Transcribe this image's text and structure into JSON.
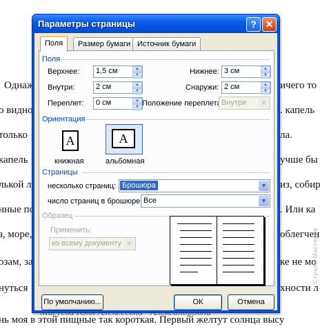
{
  "background": {
    "lines": [
      "Однаж",
      "о видно",
      "только",
      "капель",
      "лькой л",
      "нные по",
      "з, море,",
      "озам, за",
      "нуться",
      "нь моя в этой пищные так короткая. Первый желтут солнца высу"
    ],
    "right_fragments": [
      "ичего то",
      ". капель",
      "ла.",
      "учше бы",
      "из, собир",
      ". Или ка",
      "облегчени",
      "ке не мо",
      "хности л"
    ],
    "signature": "Мигуева Юля Алексеевна · Александровна",
    "watermark": "Страна Мастеров"
  },
  "dialog": {
    "title": "Параметры страницы",
    "help_label": "?",
    "close_label": "✕",
    "tabs": [
      "Поля",
      "Размер бумаги",
      "Источник бумаги"
    ],
    "active_tab": "Поля",
    "margins": {
      "group_label": "Поля",
      "top_label": "Верхнее:",
      "top_value": "1,5 см",
      "bottom_label": "Нижнее:",
      "bottom_value": "3 см",
      "inside_label": "Внутри:",
      "inside_value": "2 см",
      "outside_label": "Снаружи:",
      "outside_value": "2 см",
      "gutter_label": "Переплет:",
      "gutter_value": "0 см",
      "gutter_pos_label": "Положение переплета:",
      "gutter_pos_value": "Внутри"
    },
    "orientation": {
      "group_label": "Ориентация",
      "portrait_label": "книжная",
      "landscape_label": "альбомная",
      "glyph": "A",
      "selected": "альбомная"
    },
    "pages": {
      "group_label": "Страницы",
      "multiple_label": "несколько страниц:",
      "multiple_value": "Брошюра",
      "sheets_label": "число страниц в брошюре:",
      "sheets_value": "Все"
    },
    "preview": {
      "group_label": "Образец",
      "apply_label": "Применить:",
      "apply_value": "ко всему документу"
    },
    "buttons": {
      "default_label": "По умолчанию...",
      "ok_label": "ОК",
      "cancel_label": "Отмена"
    }
  },
  "colors": {
    "titlebar": "#0a5ce6",
    "dialog_face": "#ece9d8",
    "group_label": "#0046d5",
    "selection": "#316ac5"
  }
}
